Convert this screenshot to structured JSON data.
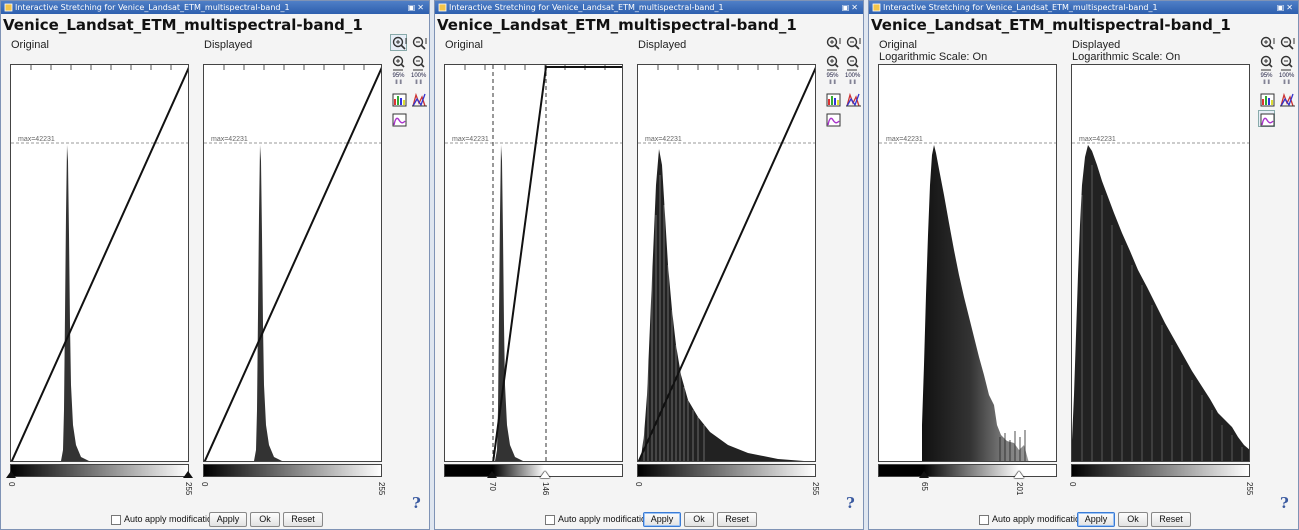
{
  "panels": [
    {
      "window_title": "Interactive Stretching for Venice_Landsat_ETM_multispectral-band_1",
      "heading": "Venice_Landsat_ETM_multispectral-band_1",
      "original_label": "Original",
      "original_sublabel": "",
      "displayed_label": "Displayed",
      "displayed_sublabel": "",
      "max_label": "max=42231",
      "orig_left_value": "0",
      "orig_right_value": "255",
      "disp_left_value": "0",
      "disp_right_value": "255",
      "auto_apply_label": "Auto apply modifications",
      "auto_apply_checked": false,
      "apply_label": "Apply",
      "ok_label": "Ok",
      "reset_label": "Reset",
      "help_label": "?",
      "zoom_95_label": "95%",
      "zoom_100_label": "100%"
    },
    {
      "window_title": "Interactive Stretching for Venice_Landsat_ETM_multispectral-band_1",
      "heading": "Venice_Landsat_ETM_multispectral-band_1",
      "original_label": "Original",
      "original_sublabel": "",
      "displayed_label": "Displayed",
      "displayed_sublabel": "",
      "max_label": "max=42231",
      "orig_left_value": "70",
      "orig_right_value": "146",
      "disp_left_value": "0",
      "disp_right_value": "255",
      "auto_apply_label": "Auto apply modifications",
      "auto_apply_checked": false,
      "apply_label": "Apply",
      "ok_label": "Ok",
      "reset_label": "Reset",
      "help_label": "?",
      "zoom_95_label": "95%",
      "zoom_100_label": "100%"
    },
    {
      "window_title": "Interactive Stretching for Venice_Landsat_ETM_multispectral-band_1",
      "heading": "Venice_Landsat_ETM_multispectral-band_1",
      "original_label": "Original",
      "original_sublabel": "Logarithmic Scale: On",
      "displayed_label": "Displayed",
      "displayed_sublabel": "Logarithmic Scale: On",
      "max_label": "max=42231",
      "orig_left_value": "65",
      "orig_right_value": "201",
      "disp_left_value": "0",
      "disp_right_value": "255",
      "auto_apply_label": "Auto apply modifications",
      "auto_apply_checked": false,
      "apply_label": "Apply",
      "ok_label": "Ok",
      "reset_label": "Reset",
      "help_label": "?",
      "zoom_95_label": "95%",
      "zoom_100_label": "100%"
    }
  ],
  "icons": {
    "zoom_in_vertical": "zoom-in-vertical-icon",
    "zoom_out_vertical": "zoom-out-vertical-icon",
    "zoom_in_horizontal": "zoom-in-horizontal-icon",
    "zoom_out_horizontal": "zoom-out-horizontal-icon",
    "color_histogram": "color-histogram-icon",
    "rgb_histogram": "rgb-histogram-icon",
    "log_scale": "log-scale-icon"
  },
  "colors": {
    "titlebar": "#2d5fae",
    "accent": "#3a7bd5",
    "histogram": "#333333"
  }
}
